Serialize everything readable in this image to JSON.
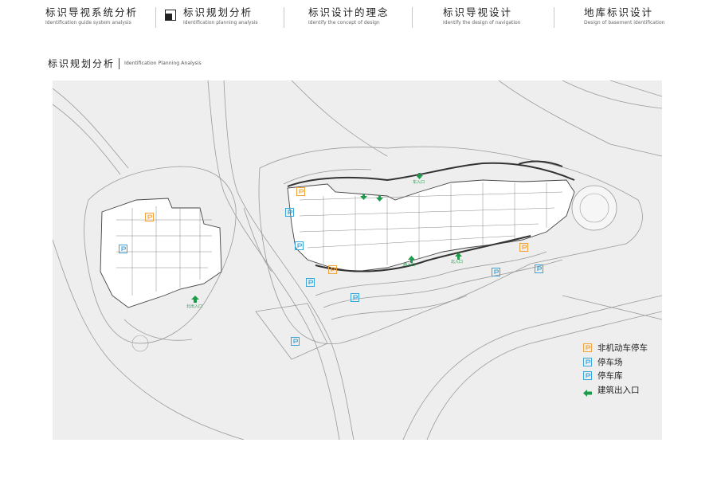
{
  "nav": [
    {
      "zh": "标识导视系统分析",
      "en": "Identification guide system analysis"
    },
    {
      "zh": "标识规划分析",
      "en": "Identification planning analysis"
    },
    {
      "zh": "标识设计的理念",
      "en": "Identify the concept of design"
    },
    {
      "zh": "标识导视设计",
      "en": "Identify the design of navigation"
    },
    {
      "zh": "地库标识设计",
      "en": "Design of basement identification"
    }
  ],
  "section": {
    "zh": "标识规划分析",
    "en": "Identification Planning Analysis"
  },
  "map_labels": {
    "entrance_north": "北出入口",
    "entrance_east": "东入口",
    "entrance_sw": "西入口",
    "entrance_se": "北入口"
  },
  "legend": [
    {
      "label": "非机动车停车",
      "icon": "bicycle-parking-icon",
      "color": "#f2a23a"
    },
    {
      "label": "停车场",
      "icon": "parking-lot-icon",
      "color": "#3aa6d8"
    },
    {
      "label": "停车库",
      "icon": "parking-garage-icon",
      "color": "#3aa6d8"
    },
    {
      "label": "建筑出入口",
      "icon": "entrance-arrow-icon",
      "color": "#1d9a4a"
    }
  ],
  "colors": {
    "orange": "#f2a23a",
    "blue": "#3aa6d8",
    "green": "#1d9a4a"
  }
}
